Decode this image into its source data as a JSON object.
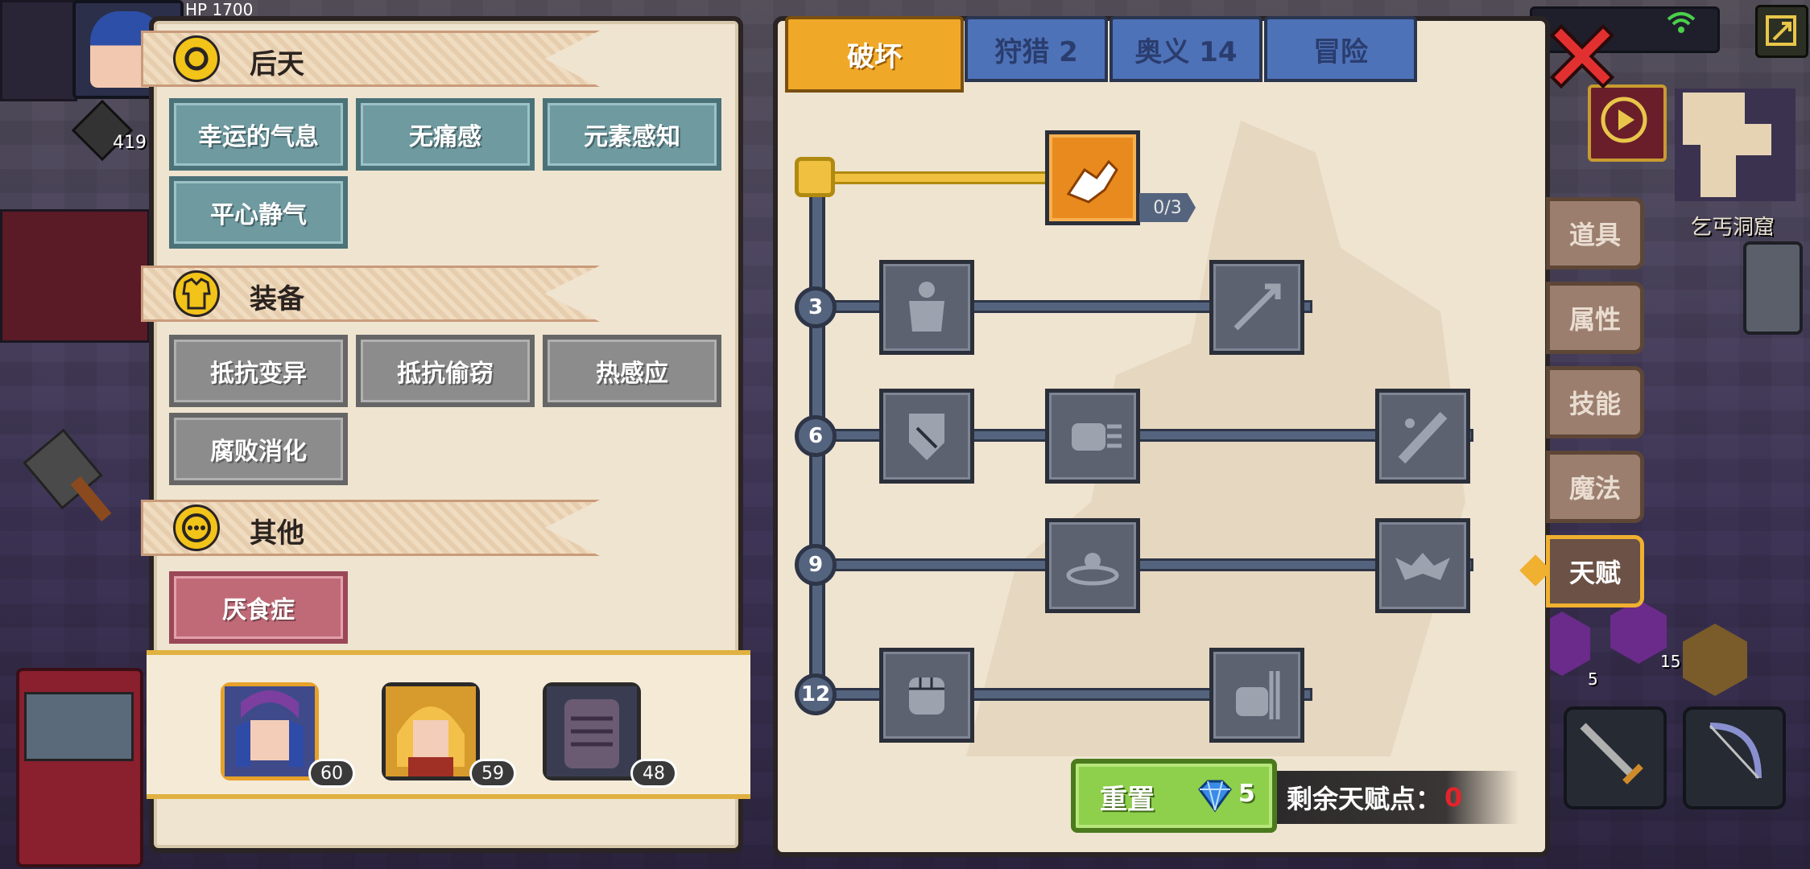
{
  "hud": {
    "hp_label": "HP 1700",
    "level_count": "419",
    "status_text": "",
    "map_name": "乞丐洞窟",
    "badge_counts": [
      "5",
      "15"
    ]
  },
  "left_panel": {
    "sections": [
      {
        "title": "后天",
        "traits": [
          "幸运的气息",
          "无痛感",
          "元素感知",
          "平心静气"
        ]
      },
      {
        "title": "装备",
        "traits": [
          "抵抗变异",
          "抵抗偷窃",
          "热感应",
          "腐败消化"
        ]
      },
      {
        "title": "其他",
        "traits": [
          "厌食症"
        ]
      }
    ],
    "party": [
      {
        "level": "60"
      },
      {
        "level": "59"
      },
      {
        "level": "48"
      }
    ]
  },
  "right_panel": {
    "tabs": [
      "破坏",
      "狩猎 2",
      "奥义 14",
      "冒险"
    ],
    "active_tab_index": 0,
    "tiers": [
      "3",
      "6",
      "9",
      "12"
    ],
    "root_talent_progress": "0/3",
    "reset_label": "重置",
    "reset_cost": "5",
    "remaining_points_label": "剩余天赋点：",
    "remaining_points_value": "0"
  },
  "side_tabs": [
    "道具",
    "属性",
    "技能",
    "魔法",
    "天赋"
  ],
  "active_side_tab": "天赋",
  "colors": {
    "active_tab": "#f0a828",
    "inactive_tab": "#4e72b8",
    "unlocked_talent": "#e98a1e",
    "locked_talent": "#5d6270",
    "points_zero": "#e3242b"
  },
  "icons": {
    "section_1": "swirl-icon",
    "section_2": "armor-icon",
    "section_3": "circle-dots-icon",
    "close": "close-icon",
    "gem": "diamond-icon"
  }
}
